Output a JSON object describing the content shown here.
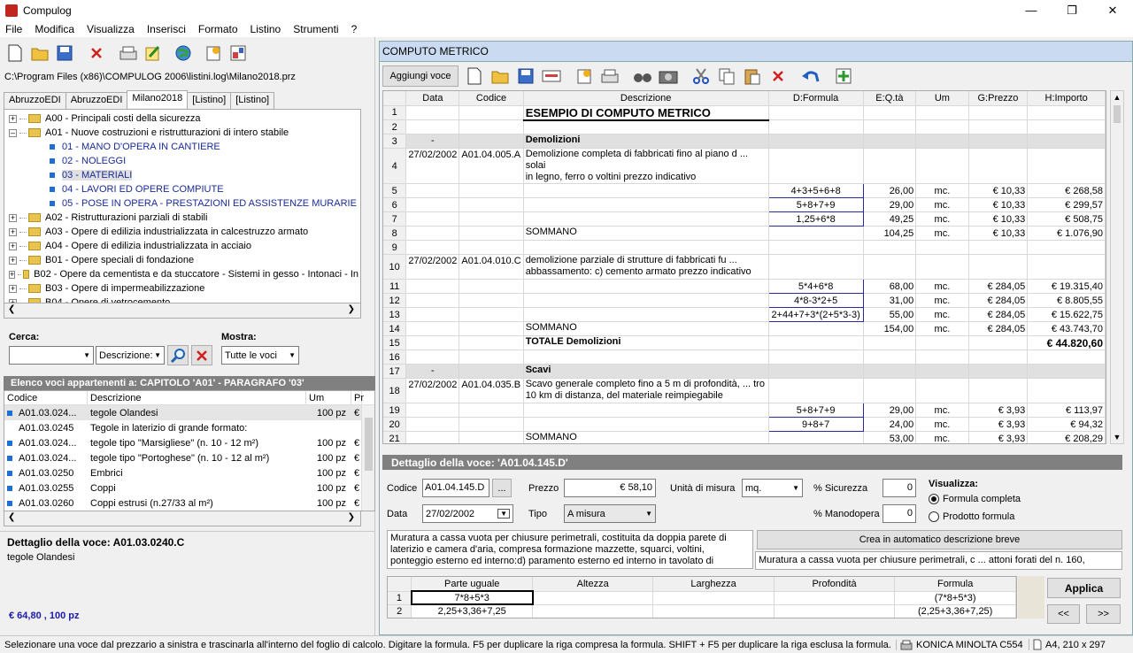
{
  "app": {
    "title": "Compulog"
  },
  "menu": [
    "File",
    "Modifica",
    "Visualizza",
    "Inserisci",
    "Formato",
    "Listino",
    "Strumenti",
    "?"
  ],
  "left": {
    "path": "C:\\Program Files (x86)\\COMPULOG 2006\\listini.log\\Milano2018.prz",
    "tabs": [
      "AbruzzoEDI",
      "AbruzzoEDI",
      "Milano2018",
      "[Listino]",
      "[Listino]"
    ],
    "tree": [
      {
        "t": "A00 - Principali costi della sicurezza",
        "k": "folder"
      },
      {
        "t": "A01 - Nuove costruzioni e ristrutturazioni di intero stabile",
        "k": "folder-open"
      },
      {
        "t": "01 - MANO D'OPERA IN CANTIERE",
        "k": "leaf"
      },
      {
        "t": "02 - NOLEGGI",
        "k": "leaf"
      },
      {
        "t": "03 - MATERIALI",
        "k": "leaf-sel"
      },
      {
        "t": "04 - LAVORI ED OPERE COMPIUTE",
        "k": "leaf"
      },
      {
        "t": "05 - POSE IN OPERA - PRESTAZIONI ED ASSISTENZE MURARIE",
        "k": "leaf"
      },
      {
        "t": "A02 - Ristrutturazioni parziali di stabili",
        "k": "folder"
      },
      {
        "t": "A03 - Opere di edilizia industrializzata in calcestruzzo armato",
        "k": "folder"
      },
      {
        "t": "A04 - Opere di edilizia industrializzata in acciaio",
        "k": "folder"
      },
      {
        "t": "B01 - Opere speciali di fondazione",
        "k": "folder"
      },
      {
        "t": "B02 - Opere da cementista e da stuccatore - Sistemi in gesso - Intonaci - In",
        "k": "folder"
      },
      {
        "t": "B03 - Opere di impermeabilizzazione",
        "k": "folder"
      },
      {
        "t": "B04 - Opere di vetrocemento",
        "k": "folder"
      }
    ],
    "cerca_label": "Cerca:",
    "mostra_label": "Mostra:",
    "desc_combo": "Descrizione:",
    "mostra_combo": "Tutte le voci",
    "elenco_title": "Elenco voci appartenenti a:    CAPITOLO 'A01' - PARAGRAFO '03'",
    "list_headers": [
      "Codice",
      "Descrizione",
      "Um",
      "Pr"
    ],
    "list_rows": [
      {
        "c": "A01.03.024...",
        "d": "tegole Olandesi",
        "u": "100 pz",
        "p": "€",
        "dot": true,
        "sel": true
      },
      {
        "c": "A01.03.0245",
        "d": "Tegole in laterizio di grande formato:",
        "u": "",
        "p": "",
        "dot": false,
        "sel": false
      },
      {
        "c": "A01.03.024...",
        "d": "tegole tipo \"Marsigliese\" (n. 10 - 12 m²)",
        "u": "100 pz",
        "p": "€",
        "dot": true,
        "sel": false
      },
      {
        "c": "A01.03.024...",
        "d": "tegole tipo \"Portoghese\" (n. 10 - 12 al m²)",
        "u": "100 pz",
        "p": "€",
        "dot": true,
        "sel": false
      },
      {
        "c": "A01.03.0250",
        "d": "Embrici",
        "u": "100 pz",
        "p": "€",
        "dot": true,
        "sel": false
      },
      {
        "c": "A01.03.0255",
        "d": "Coppi",
        "u": "100 pz",
        "p": "€",
        "dot": true,
        "sel": false
      },
      {
        "c": "A01.03.0260",
        "d": "Coppi estrusi (n.27/33 al m²)",
        "u": "100 pz",
        "p": "€",
        "dot": true,
        "sel": false
      }
    ],
    "det_title": "Dettaglio della voce:  A01.03.0240.C",
    "det_desc": "tegole Olandesi",
    "det_price": "€ 64,80 , 100 pz"
  },
  "right": {
    "title": "COMPUTO METRICO",
    "add_btn": "Aggiungi voce",
    "headers": [
      "Data",
      "Codice",
      "Descrizione",
      "D:Formula",
      "E:Q.tà",
      "Um",
      "G:Prezzo",
      "H:Importo"
    ],
    "rows": [
      {
        "n": "1",
        "desc": "ESEMPIO DI COMPUTO METRICO",
        "title": true
      },
      {
        "n": "2"
      },
      {
        "n": "3",
        "data": "-",
        "desc": "Demolizioni",
        "bold": true,
        "shade": true
      },
      {
        "n": "4",
        "data": "27/02/2002",
        "cod": "A01.04.005.A",
        "desc": "Demolizione completa di fabbricati fino al piano d ...  solai",
        "desc2": "in legno, ferro o voltini prezzo indicativo",
        "tall": true
      },
      {
        "n": "5",
        "f": "4+3+5+6+8",
        "q": "26,00",
        "um": "mc.",
        "p": "€ 10,33",
        "imp": "€ 268,58"
      },
      {
        "n": "6",
        "f": "5+8+7+9",
        "q": "29,00",
        "um": "mc.",
        "p": "€ 10,33",
        "imp": "€ 299,57"
      },
      {
        "n": "7",
        "f": "1,25+6*8",
        "q": "49,25",
        "um": "mc.",
        "p": "€ 10,33",
        "imp": "€ 508,75"
      },
      {
        "n": "8",
        "desc": "SOMMANO",
        "q": "104,25",
        "um": "mc.",
        "p": "€ 10,33",
        "imp": "€ 1.076,90"
      },
      {
        "n": "9"
      },
      {
        "n": "10",
        "data": "27/02/2002",
        "cod": "A01.04.010.C",
        "desc": "demolizione parziale di strutture di fabbricati fu ...",
        "desc2": "abbassamento: c) cemento armato prezzo indicativo",
        "tall": true
      },
      {
        "n": "11",
        "f": "5*4+6*8",
        "q": "68,00",
        "um": "mc.",
        "p": "€ 284,05",
        "imp": "€ 19.315,40"
      },
      {
        "n": "12",
        "f": "4*8-3*2+5",
        "q": "31,00",
        "um": "mc.",
        "p": "€ 284,05",
        "imp": "€ 8.805,55"
      },
      {
        "n": "13",
        "f": "2+44+7+3*(2+5*3-3)",
        "q": "55,00",
        "um": "mc.",
        "p": "€ 284,05",
        "imp": "€ 15.622,75"
      },
      {
        "n": "14",
        "desc": "SOMMANO",
        "q": "154,00",
        "um": "mc.",
        "p": "€ 284,05",
        "imp": "€ 43.743,70"
      },
      {
        "n": "15",
        "desc": "TOTALE Demolizioni",
        "bold": true,
        "imp": "€ 44.820,60",
        "impbold": true
      },
      {
        "n": "16"
      },
      {
        "n": "17",
        "data": "-",
        "desc": "Scavi",
        "bold": true,
        "shade": true
      },
      {
        "n": "18",
        "data": "27/02/2002",
        "cod": "A01.04.035.B",
        "desc": "Scavo generale completo fino a 5 m di profondità,  ... tro",
        "desc2": "10 km di distanza, del materiale reimpiegabile",
        "tall": true
      },
      {
        "n": "19",
        "f": "5+8+7+9",
        "q": "29,00",
        "um": "mc.",
        "p": "€ 3,93",
        "imp": "€ 113,97"
      },
      {
        "n": "20",
        "f": "9+8+7",
        "q": "24,00",
        "um": "mc.",
        "p": "€ 3,93",
        "imp": "€ 94,32"
      },
      {
        "n": "21",
        "desc": "SOMMANO",
        "q": "53,00",
        "um": "mc.",
        "p": "€ 3,93",
        "imp": "€ 208,29"
      }
    ],
    "det_title": "Dettaglio della voce:  'A01.04.145.D'",
    "codice_lbl": "Codice",
    "codice": "A01.04.145.D",
    "dots": "...",
    "prezzo_lbl": "Prezzo",
    "prezzo": "€ 58,10",
    "um_lbl": "Unità di misura",
    "um": "mq.",
    "sic_lbl": "% Sicurezza",
    "sic": "0",
    "mano_lbl": "% Manodopera",
    "mano": "0",
    "data_lbl": "Data",
    "data": "27/02/2002",
    "tipo_lbl": "Tipo",
    "tipo": "A misura",
    "vis_lbl": "Visualizza:",
    "r1": "Formula completa",
    "r2": "Prodotto formula",
    "long_desc": "Muratura a cassa vuota per chiusure perimetrali, costituita da doppia parete di laterizio e camera d'aria, compresa formazione mazzette, squarci, voltini, ponteggio esterno ed interno:d) paramento esterno ed interno in tavolato di",
    "crea_btn": "Crea in automatico descrizione breve",
    "short_desc": "Muratura a cassa vuota per chiusure perimetrali, c ... attoni forati del n. 160,",
    "meas_headers": [
      "Parte uguale",
      "Altezza",
      "Larghezza",
      "Profondità",
      "Formula"
    ],
    "meas_rows": [
      {
        "n": "1",
        "pu": "7*8+5*3",
        "f": "(7*8+5*3)"
      },
      {
        "n": "2",
        "pu": "2,25+3,36+7,25",
        "f": "(2,25+3,36+7,25)"
      }
    ],
    "applica": "Applica",
    "prev": "<<",
    "next": ">>"
  },
  "status": {
    "msg": "Selezionare una voce dal prezzario a sinistra e trascinarla all'interno del foglio di calcolo. Digitare la formula. F5 per duplicare la riga compresa la formula. SHIFT + F5 per duplicare la riga esclusa la formula.",
    "printer": "KONICA MINOLTA C554",
    "paper": "A4, 210 x 297"
  }
}
